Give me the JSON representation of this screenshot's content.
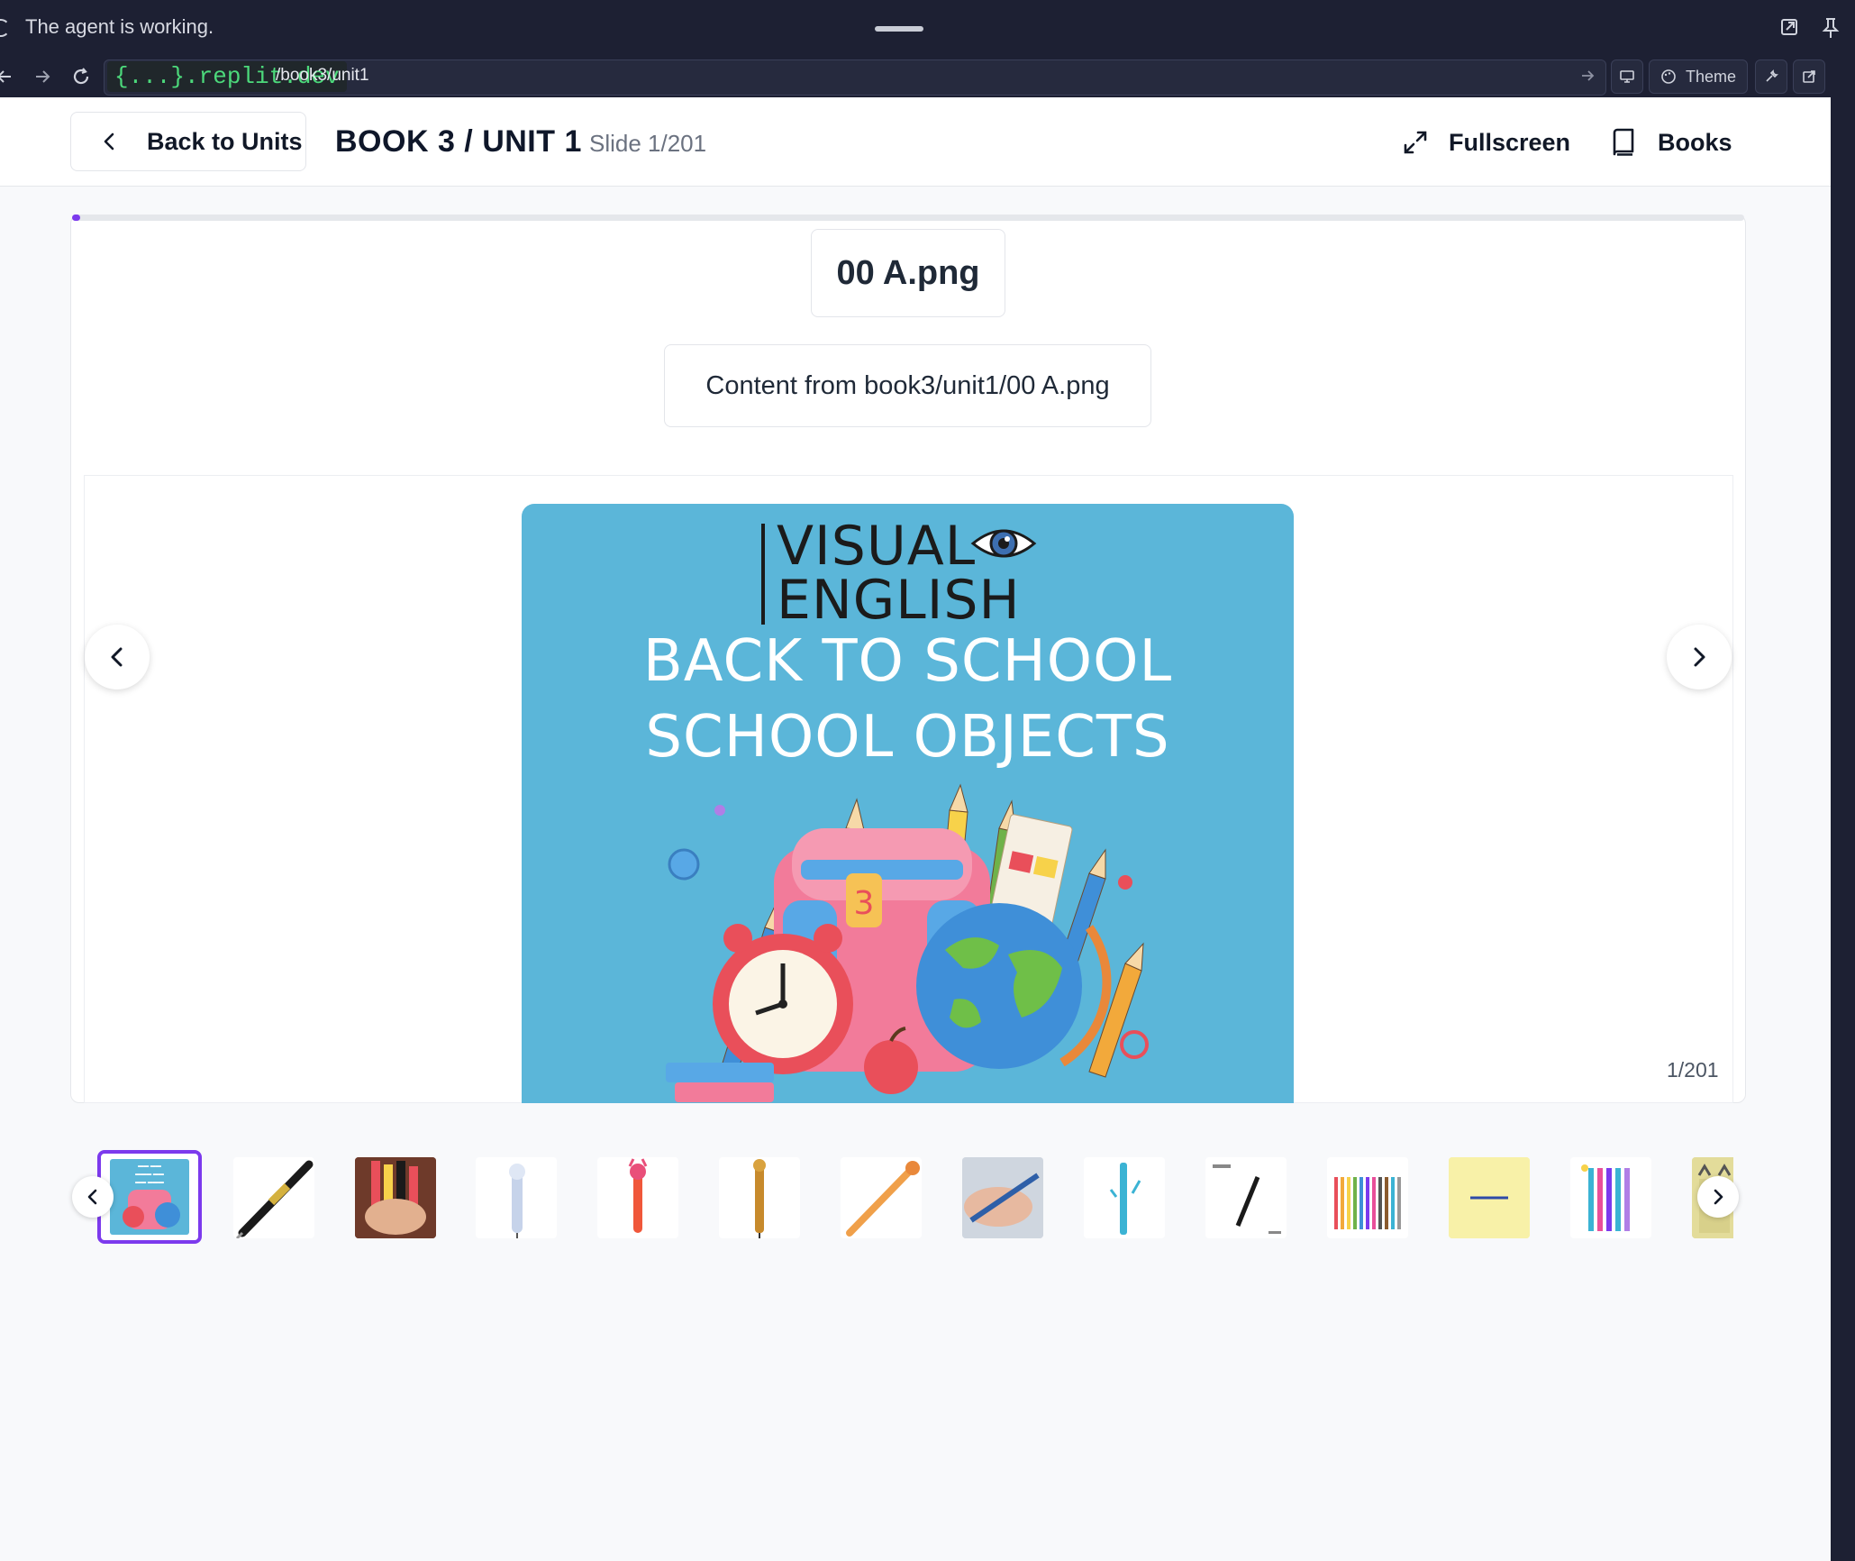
{
  "browser": {
    "status_text": "The agent is working.",
    "url_host": "{...}.replit.dev",
    "url_path": "/book3/unit1",
    "theme_label": "Theme"
  },
  "header": {
    "back_label": "Back to Units",
    "title": "BOOK 3 / UNIT 1",
    "slide_label": "Slide 1/201",
    "fullscreen_label": "Fullscreen",
    "books_label": "Books"
  },
  "slide": {
    "filename": "00 A.png",
    "content_text": "Content from book3/unit1/00 A.png",
    "counter": "1/201",
    "progress_fraction": 0.005,
    "image": {
      "brand_line1": "VISUAL",
      "brand_line2": "ENGLISH",
      "heading1": "BACK TO SCHOOL",
      "heading2": "SCHOOL OBJECTS",
      "background_color": "#5bb6d9"
    }
  },
  "thumbnails": [
    {
      "name": "thumb-cover",
      "active": true
    },
    {
      "name": "thumb-pen-black",
      "active": false
    },
    {
      "name": "thumb-novelty-pens",
      "active": false
    },
    {
      "name": "thumb-unicorn-pen",
      "active": false
    },
    {
      "name": "thumb-red-pen",
      "active": false
    },
    {
      "name": "thumb-wooden-pen",
      "active": false
    },
    {
      "name": "thumb-orange-pencil",
      "active": false
    },
    {
      "name": "thumb-hand-pen",
      "active": false
    },
    {
      "name": "thumb-blue-pens",
      "active": false
    },
    {
      "name": "thumb-parker-pen",
      "active": false
    },
    {
      "name": "thumb-marker-set",
      "active": false
    },
    {
      "name": "thumb-yellow-card",
      "active": false
    },
    {
      "name": "thumb-gel-pens",
      "active": false
    },
    {
      "name": "thumb-partial",
      "active": false
    }
  ],
  "colors": {
    "accent": "#7c3aed",
    "chrome_bg": "#1d2033",
    "url_host_green": "#4cd97b"
  }
}
